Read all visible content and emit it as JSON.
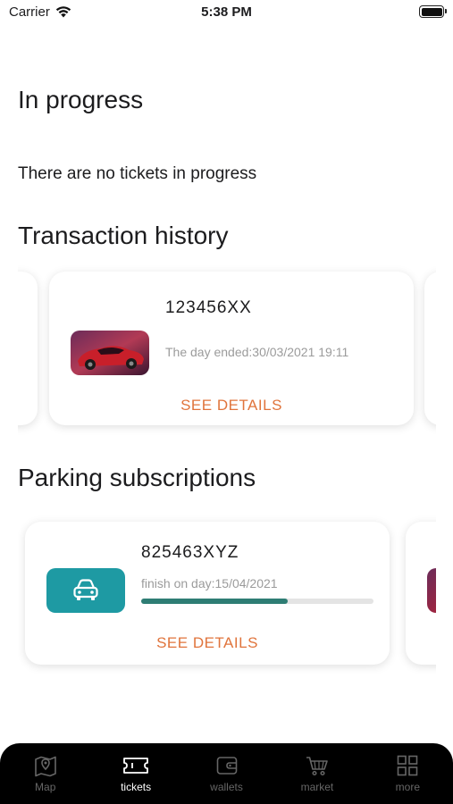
{
  "status_bar": {
    "carrier": "Carrier",
    "time": "5:38 PM"
  },
  "in_progress": {
    "title": "In progress",
    "empty_text": "There are no tickets in progress"
  },
  "transaction_history": {
    "title": "Transaction history",
    "card": {
      "code": "123456XX",
      "subtitle": "The day ended:30/03/2021 19:11",
      "link": "SEE DETAILS"
    }
  },
  "parking_subscriptions": {
    "title": "Parking subscriptions",
    "card": {
      "code": "825463XYZ",
      "subtitle": "finish on day:15/04/2021",
      "progress": 0.63,
      "link": "SEE DETAILS"
    }
  },
  "tab_bar": {
    "items": [
      {
        "label": "Map",
        "icon": "map-icon",
        "active": false
      },
      {
        "label": "tickets",
        "icon": "ticket-icon",
        "active": true
      },
      {
        "label": "wallets",
        "icon": "wallet-icon",
        "active": false
      },
      {
        "label": "market",
        "icon": "cart-icon",
        "active": false
      },
      {
        "label": "more",
        "icon": "grid-icon",
        "active": false
      }
    ]
  },
  "colors": {
    "accent": "#e0743c",
    "teal": "#1e9aa3",
    "progress": "#2e7d74",
    "tab_bar": "#000000"
  }
}
